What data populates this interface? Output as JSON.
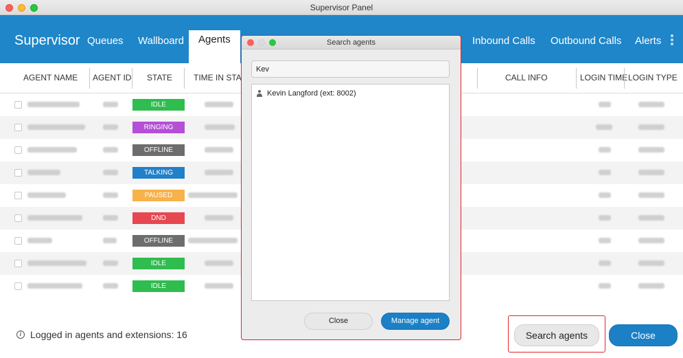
{
  "window": {
    "title": "Supervisor Panel"
  },
  "nav": {
    "brand": "Supervisor",
    "items": [
      "Queues",
      "Wallboard",
      "Agents",
      "Inbound Calls",
      "Outbound Calls",
      "Alerts"
    ]
  },
  "table": {
    "headers": [
      "AGENT NAME",
      "AGENT ID",
      "STATE",
      "TIME IN STAT",
      "CALL INFO",
      "LOGIN TIME",
      "LOGIN TYPE"
    ],
    "rows": [
      {
        "state": "IDLE",
        "color": "#2ebd4e"
      },
      {
        "state": "RINGING",
        "color": "#b44fd6"
      },
      {
        "state": "OFFLINE",
        "color": "#6d6d6d"
      },
      {
        "state": "TALKING",
        "color": "#2280c8"
      },
      {
        "state": "PAUSED",
        "color": "#f7b24a"
      },
      {
        "state": "DND",
        "color": "#e74750"
      },
      {
        "state": "OFFLINE",
        "color": "#6d6d6d"
      },
      {
        "state": "IDLE",
        "color": "#2ebd4e"
      },
      {
        "state": "IDLE",
        "color": "#2ebd4e"
      }
    ]
  },
  "footer": {
    "info_icon": "info-icon",
    "logged_in_text": "Logged in agents and extensions: 16",
    "search_agents_label": "Search agents",
    "close_label": "Close"
  },
  "dialog": {
    "title": "Search agents",
    "search_value": "Kev",
    "results": [
      {
        "label": "Kevin Langford (ext: 8002)",
        "icon": "person-icon"
      }
    ],
    "close_label": "Close",
    "manage_label": "Manage agent"
  },
  "colors": {
    "accent": "#1f86c9",
    "highlight": "#e0232b"
  }
}
